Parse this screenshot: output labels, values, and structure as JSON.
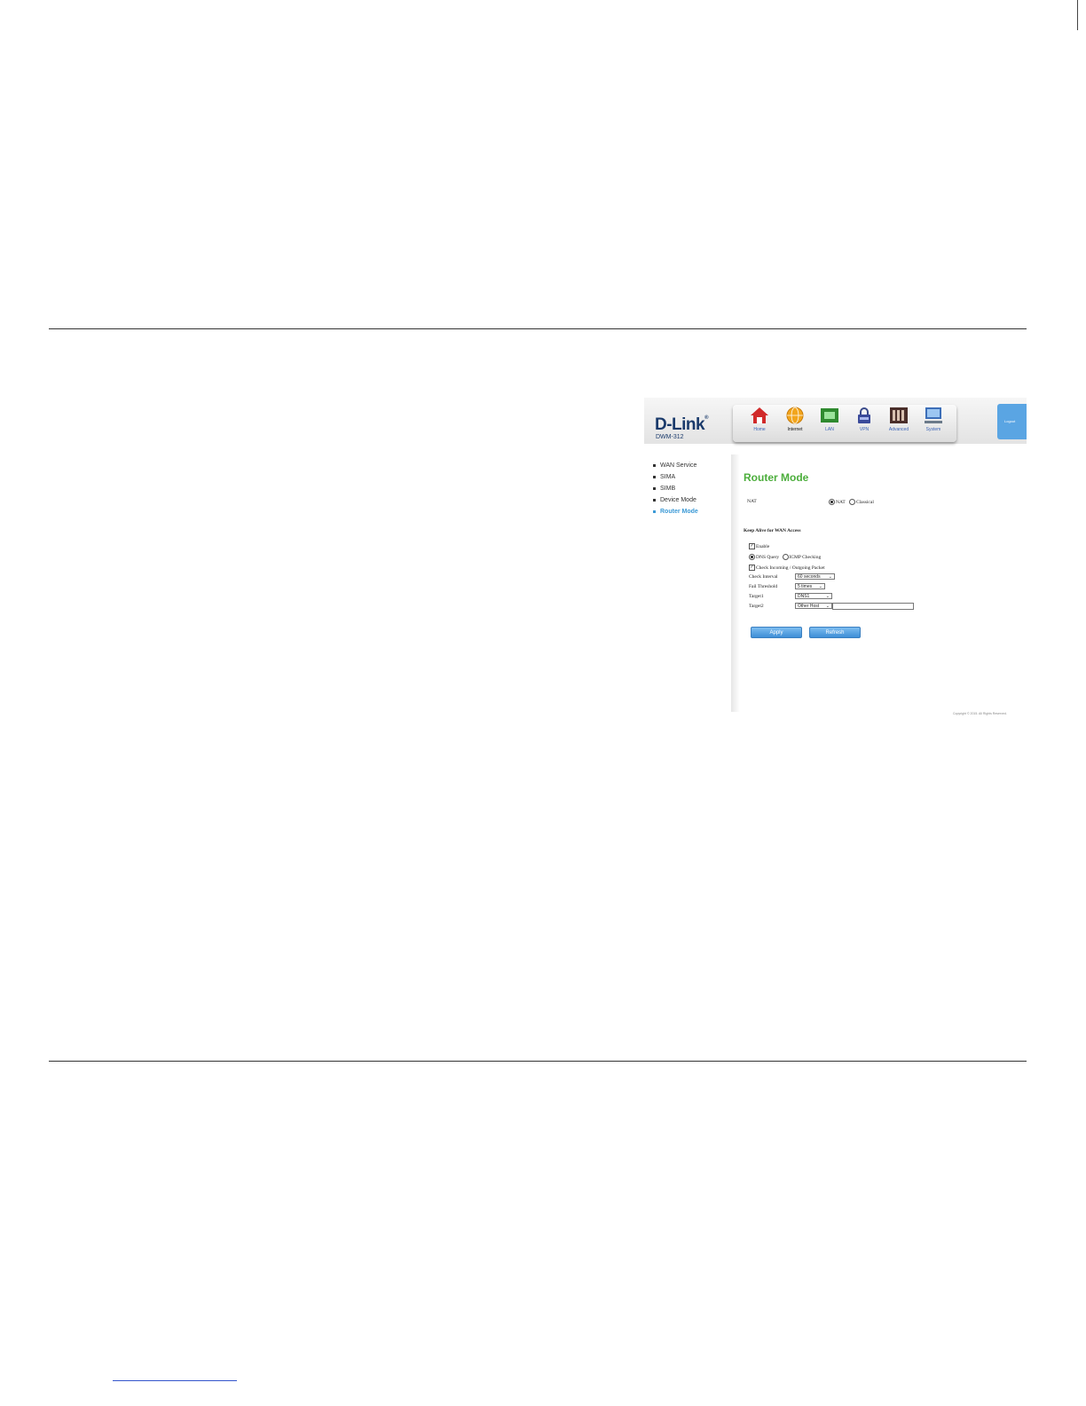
{
  "header": {
    "logo_text": "D-Link",
    "logo_mark": "®",
    "model": "DWM-312",
    "logout_label": "Logout"
  },
  "nav": [
    {
      "label": "Home",
      "icon": "home-icon"
    },
    {
      "label": "Internet",
      "icon": "globe-icon"
    },
    {
      "label": "LAN",
      "icon": "lan-icon"
    },
    {
      "label": "VPN",
      "icon": "lock-icon"
    },
    {
      "label": "Advanced",
      "icon": "advanced-icon"
    },
    {
      "label": "System",
      "icon": "monitor-icon"
    }
  ],
  "sidebar": {
    "items": [
      {
        "label": "WAN Service"
      },
      {
        "label": "SIMA"
      },
      {
        "label": "SIMB"
      },
      {
        "label": "Device Mode"
      },
      {
        "label": "Router Mode"
      }
    ]
  },
  "main": {
    "title": "Router Mode",
    "nat_label": "NAT",
    "nat_option": "NAT",
    "classical_option": "Classical",
    "keepalive_heading": "Keep Alive for WAN Access",
    "enable_label": "Enable",
    "dns_query_label": "DNS Query",
    "icmp_label": "ICMP Checking",
    "check_traffic_label": "Check Incoming / Outgoing Packet",
    "check_interval_label": "Check Interval",
    "check_interval_value": "60 seconds",
    "fail_threshold_label": "Fail Threshold",
    "fail_threshold_value": "5 times",
    "target1_label": "Target1",
    "target1_value": "DNS1",
    "target2_label": "Target2",
    "target2_value": "Other Host",
    "target2_host": "",
    "apply_label": "Apply",
    "refresh_label": "Refresh"
  },
  "footer": {
    "copyright": "Copyright © 2015. All Rights Reserved."
  },
  "colors": {
    "title_green": "#4cae3c",
    "link_blue": "#3c9ad6",
    "button_blue": "#3d8ed6",
    "logo_navy": "#1a3a6b"
  }
}
